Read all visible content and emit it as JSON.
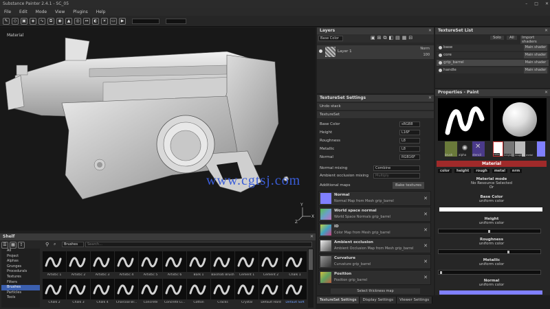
{
  "window": {
    "title": "Substance Painter 2.4.1 - SC_05",
    "controls": [
      "–",
      "□",
      "✕"
    ]
  },
  "menu": [
    "File",
    "Edit",
    "Mode",
    "View",
    "Plugins",
    "Help"
  ],
  "viewport": {
    "label": "Material",
    "watermark": "www.cgtsj.com"
  },
  "layers": {
    "title": "Layers",
    "channel": "Base Color",
    "layer_name": "Layer 1",
    "blend": "Norm",
    "opacity": "100"
  },
  "textureset_settings": {
    "title": "TextureSet Settings",
    "undo_stack": "Undo stack",
    "textureset": "TextureSet",
    "channels": [
      {
        "name": "Base Color",
        "format": "sRGB8"
      },
      {
        "name": "Height",
        "format": "L16F"
      },
      {
        "name": "Roughness",
        "format": "L8"
      },
      {
        "name": "Metallic",
        "format": "L8"
      },
      {
        "name": "Normal",
        "format": "RGB16F"
      }
    ],
    "normal_mixing_label": "Normal mixing",
    "normal_mixing_value": "Combine",
    "ao_mixing_label": "Ambient occlusion mixing",
    "ao_mixing_value": "Multiply",
    "additional_maps": "Additional maps",
    "bake_button": "Bake textures",
    "maps": [
      {
        "name": "Normal",
        "desc": "Normal Map from Mesh grip_barrel",
        "color": "#8080ff"
      },
      {
        "name": "World space normal",
        "desc": "World Space Normals grip_barrel",
        "color": "#6aa0c8"
      },
      {
        "name": "ID",
        "desc": "Color Map from Mesh grip_barrel",
        "color": "#b0c040"
      },
      {
        "name": "Ambient occlusion",
        "desc": "Ambient Occlusion Map from Mesh grip_barrel",
        "color": "#9a9a9a"
      },
      {
        "name": "Curvature",
        "desc": "Curvature grip_barrel",
        "color": "#7a7a7a"
      },
      {
        "name": "Position",
        "desc": "Position grip_barrel",
        "color": "#b0b040"
      }
    ],
    "thickness_button": "Select thickness map"
  },
  "bottom_tabs": [
    "TextureSet Settings",
    "Display Settings",
    "Viewer Settings"
  ],
  "textureset_list": {
    "title": "TextureSet List",
    "solo": "Solo",
    "all": "All",
    "import": "Import shaders",
    "sets": [
      {
        "name": "base",
        "shader": "Main shader"
      },
      {
        "name": "core",
        "shader": "Main shader"
      },
      {
        "name": "grip_barrel",
        "shader": "Main shader"
      },
      {
        "name": "handle",
        "shader": "Main shader"
      }
    ]
  },
  "properties": {
    "title": "Properties - Paint",
    "brush_thumbs": [
      "brush",
      "alpha",
      "stencil"
    ],
    "material_thumbs": [
      "color",
      "height",
      "rough",
      "metal",
      "nrm"
    ],
    "material_header": "Material",
    "material_channels": [
      "color",
      "height",
      "rough",
      "metal",
      "nrm"
    ],
    "material_mode": "Material mode",
    "no_resource": "No Resource Selected",
    "or": "Or",
    "channels": [
      {
        "name": "Base Color",
        "sub": "uniform color"
      },
      {
        "name": "Height",
        "sub": "uniform color"
      },
      {
        "name": "Roughness",
        "sub": "uniform color"
      },
      {
        "name": "Metallic",
        "sub": "uniform color"
      },
      {
        "name": "Normal",
        "sub": "uniform color"
      }
    ]
  },
  "shelf": {
    "title": "Shelf",
    "filter": "Brushes",
    "search_placeholder": "Search...",
    "categories": [
      "All",
      "Project",
      "Alphas",
      "Grunges",
      "Procedurals",
      "Textures",
      "Filters",
      "Brushes",
      "Particles",
      "Tools"
    ],
    "selected_category": "Brushes",
    "brushes_row1": [
      "Artistic 1",
      "Artistic 2",
      "Artistic 3",
      "Artistic 4",
      "Artistic 5",
      "Artistic 6",
      "Bark 1",
      "Basmati Brush",
      "Cement 1",
      "Cement 2",
      "Chalk 1"
    ],
    "brushes_row2": [
      "Chalk 2",
      "Chalk 3",
      "Chalk 4",
      "Charcoal Br...",
      "Concrete",
      "Concrete Li...",
      "Cotton",
      "Cracks",
      "Crystal",
      "Default Hard",
      "Default Soft"
    ]
  }
}
